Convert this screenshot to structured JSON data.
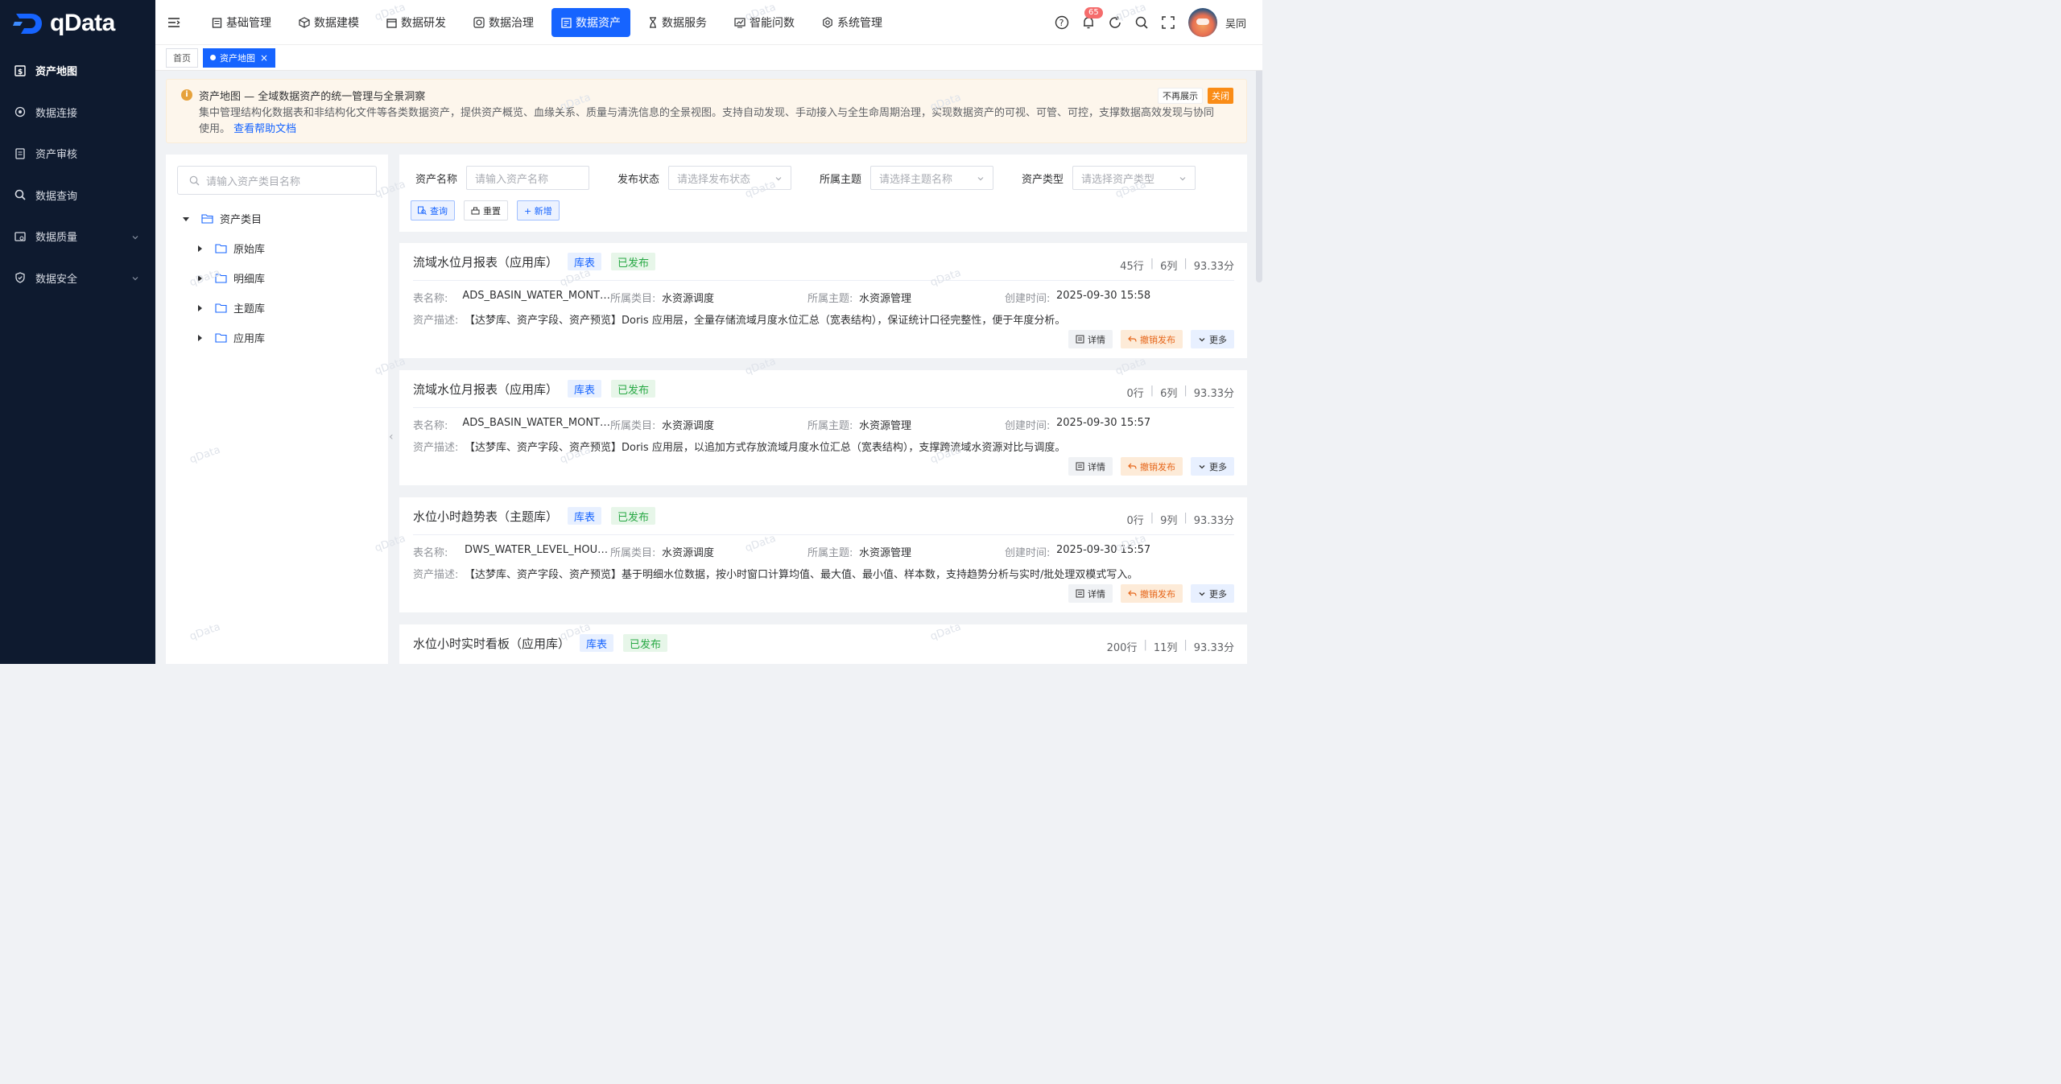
{
  "app": {
    "name": "qData"
  },
  "sidebar": {
    "items": [
      {
        "label": "资产地图",
        "icon": "asset-map-icon",
        "active": true
      },
      {
        "label": "数据连接",
        "icon": "connection-icon"
      },
      {
        "label": "资产审核",
        "icon": "audit-icon"
      },
      {
        "label": "数据查询",
        "icon": "search-icon"
      },
      {
        "label": "数据质量",
        "icon": "quality-icon",
        "expandable": true
      },
      {
        "label": "数据安全",
        "icon": "security-icon",
        "expandable": true
      }
    ]
  },
  "header": {
    "menu": [
      {
        "label": "基础管理",
        "icon": "doc-icon"
      },
      {
        "label": "数据建模",
        "icon": "cube-icon"
      },
      {
        "label": "数据研发",
        "icon": "calendar-icon"
      },
      {
        "label": "数据治理",
        "icon": "governance-icon"
      },
      {
        "label": "数据资产",
        "icon": "asset-icon",
        "active": true
      },
      {
        "label": "数据服务",
        "icon": "hourglass-icon"
      },
      {
        "label": "智能问数",
        "icon": "chart-icon"
      },
      {
        "label": "系统管理",
        "icon": "gear-icon"
      }
    ],
    "notification_count": "65",
    "user_name": "吴同"
  },
  "tabs": [
    {
      "label": "首页"
    },
    {
      "label": "资产地图",
      "active": true
    }
  ],
  "alert": {
    "title": "资产地图 — 全域数据资产的统一管理与全景洞察",
    "desc": "集中管理结构化数据表和非结构化文件等各类数据资产，提供资产概览、血缘关系、质量与清洗信息的全景视图。支持自动发现、手动接入与全生命周期治理，实现数据资产的可视、可管、可控，支撑数据高效发现与协同使用。",
    "link": "查看帮助文档",
    "dismiss_label": "不再展示",
    "close_label": "关闭"
  },
  "tree": {
    "search_placeholder": "请输入资产类目名称",
    "root": "资产类目",
    "children": [
      "原始库",
      "明细库",
      "主题库",
      "应用库"
    ]
  },
  "filter": {
    "fields": [
      {
        "label": "资产名称",
        "placeholder": "请输入资产名称"
      },
      {
        "label": "发布状态",
        "placeholder": "请选择发布状态"
      },
      {
        "label": "所属主题",
        "placeholder": "请选择主题名称"
      },
      {
        "label": "资产类型",
        "placeholder": "请选择资产类型"
      }
    ],
    "query_label": "查询",
    "reset_label": "重置",
    "add_label": "+ 新增"
  },
  "labels": {
    "table_name": "表名称:",
    "category": "所属类目:",
    "theme": "所属主题:",
    "created": "创建时间:",
    "desc": "资产描述:",
    "detail": "详情",
    "revoke": "撤销发布",
    "more": "更多"
  },
  "cards": [
    {
      "title": "流域水位月报表（应用库）",
      "type_tag": "库表",
      "status_tag": "已发布",
      "rows": "45行",
      "cols": "6列",
      "score": "93.33分",
      "table_name": "ADS_BASIN_WATER_MONT…",
      "category": "水资源调度",
      "theme": "水资源管理",
      "created": "2025-09-30 15:58",
      "desc": "【达梦库、资产字段、资产预览】Doris 应用层，全量存储流域月度水位汇总（宽表结构），保证统计口径完整性，便于年度分析。"
    },
    {
      "title": "流域水位月报表（应用库）",
      "type_tag": "库表",
      "status_tag": "已发布",
      "rows": "0行",
      "cols": "6列",
      "score": "93.33分",
      "table_name": "ADS_BASIN_WATER_MONT…",
      "category": "水资源调度",
      "theme": "水资源管理",
      "created": "2025-09-30 15:57",
      "desc": "【达梦库、资产字段、资产预览】Doris 应用层，以追加方式存放流域月度水位汇总（宽表结构），支撑跨流域水资源对比与调度。"
    },
    {
      "title": "水位小时趋势表（主题库）",
      "type_tag": "库表",
      "status_tag": "已发布",
      "rows": "0行",
      "cols": "9列",
      "score": "93.33分",
      "table_name": "DWS_WATER_LEVEL_HOU…",
      "category": "水资源调度",
      "theme": "水资源管理",
      "created": "2025-09-30 15:57",
      "desc": "【达梦库、资产字段、资产预览】基于明细水位数据，按小时窗口计算均值、最大值、最小值、样本数，支持趋势分析与实时/批处理双模式写入。"
    },
    {
      "title": "水位小时实时看板（应用库）",
      "type_tag": "库表",
      "status_tag": "已发布",
      "rows": "200行",
      "cols": "11列",
      "score": "93.33分"
    }
  ],
  "watermark": "qData"
}
